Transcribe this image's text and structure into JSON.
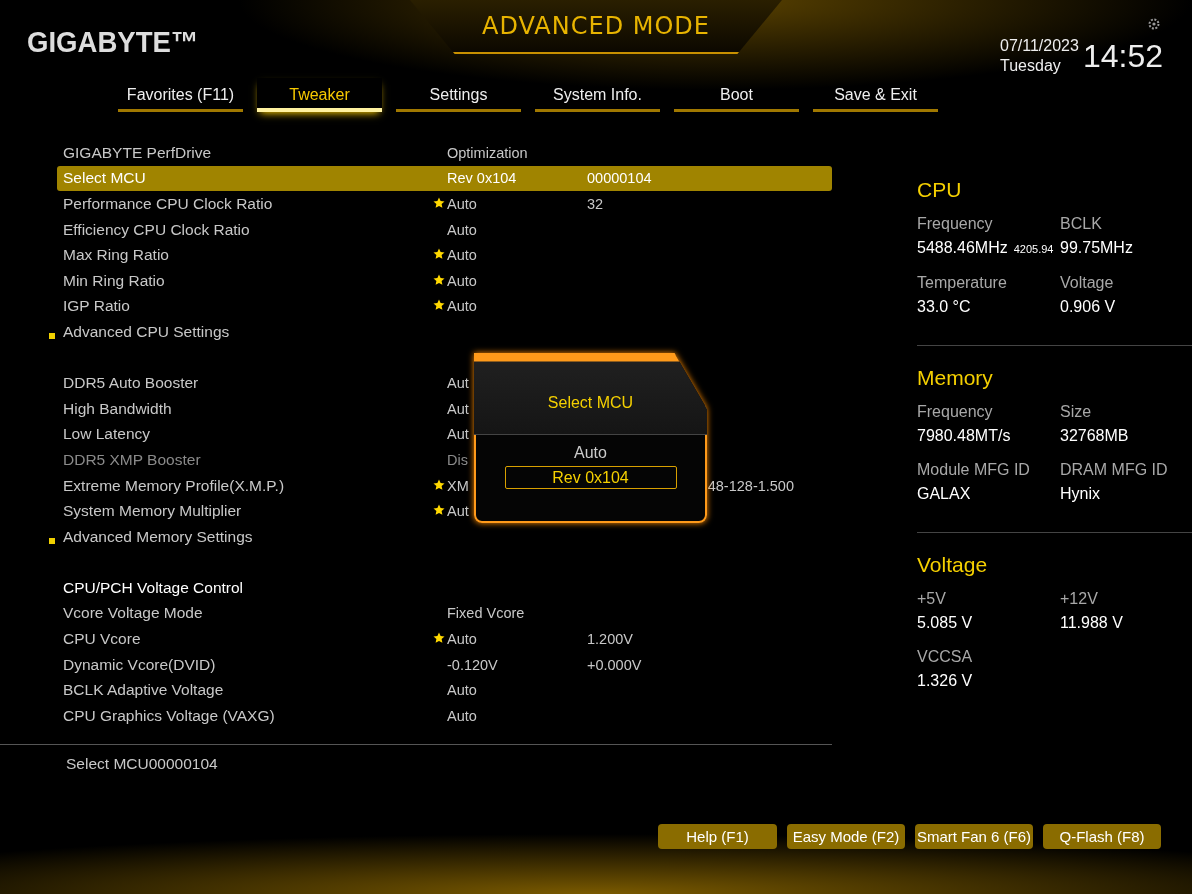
{
  "header": {
    "logo": "GIGABYTE™",
    "mode": "ADVANCED MODE",
    "date": "07/11/2023",
    "weekday": "Tuesday",
    "time": "14:52"
  },
  "tabs": [
    {
      "label": "Favorites (F11)",
      "selected": false
    },
    {
      "label": "Tweaker",
      "selected": true
    },
    {
      "label": "Settings",
      "selected": false
    },
    {
      "label": "System Info.",
      "selected": false
    },
    {
      "label": "Boot",
      "selected": false
    },
    {
      "label": "Save & Exit",
      "selected": false
    }
  ],
  "settings": {
    "groups": [
      [
        {
          "kind": "setting",
          "label": "GIGABYTE PerfDrive",
          "value": "Optimization",
          "starred": false,
          "selected": false,
          "disabled": false
        },
        {
          "kind": "setting",
          "label": "Select MCU",
          "value": "Rev 0x104",
          "value_2": "00000104",
          "starred": false,
          "selected": true,
          "disabled": false
        },
        {
          "kind": "setting",
          "label": "Performance CPU Clock Ratio",
          "value": "Auto",
          "value_2": "32",
          "starred": true,
          "selected": false,
          "disabled": false
        },
        {
          "kind": "setting",
          "label": "Efficiency CPU Clock Ratio",
          "value": "Auto",
          "starred": false,
          "selected": false,
          "disabled": false
        },
        {
          "kind": "setting",
          "label": "Max Ring Ratio",
          "value": "Auto",
          "starred": true,
          "selected": false,
          "disabled": false
        },
        {
          "kind": "setting",
          "label": "Min Ring Ratio",
          "value": "Auto",
          "starred": true,
          "selected": false,
          "disabled": false
        },
        {
          "kind": "setting",
          "label": "IGP Ratio",
          "value": "Auto",
          "starred": true,
          "selected": false,
          "disabled": false
        },
        {
          "kind": "submenu",
          "label": "Advanced CPU Settings"
        }
      ],
      [
        {
          "kind": "covered",
          "label": "DDR5 Auto Booster",
          "value": "Aut",
          "starred": false,
          "selected": false,
          "disabled": false
        },
        {
          "kind": "covered",
          "label": "High Bandwidth",
          "value": "Aut",
          "starred": false,
          "selected": false,
          "disabled": false
        },
        {
          "kind": "covered",
          "label": "Low Latency",
          "value": "Aut",
          "starred": false,
          "selected": false,
          "disabled": false
        },
        {
          "kind": "covered",
          "label": "DDR5 XMP Booster",
          "value": "Dis",
          "starred": false,
          "selected": false,
          "disabled": true
        },
        {
          "kind": "covered",
          "label": "Extreme Memory Profile(X.M.P.)",
          "value": "XM",
          "value_2": "48-128-1.500",
          "starred": true,
          "selected": false,
          "disabled": false
        },
        {
          "kind": "covered",
          "label": "System Memory Multiplier",
          "value": "Aut",
          "starred": true,
          "selected": false,
          "disabled": false
        },
        {
          "kind": "submenu",
          "label": "Advanced Memory Settings"
        }
      ],
      [
        {
          "kind": "header",
          "label": "CPU/PCH Voltage Control"
        },
        {
          "kind": "setting",
          "label": "Vcore Voltage Mode",
          "value": "Fixed Vcore",
          "starred": false,
          "selected": false,
          "disabled": false
        },
        {
          "kind": "setting",
          "label": "CPU Vcore",
          "value": "Auto",
          "value_2": "1.200V",
          "starred": true,
          "selected": false,
          "disabled": false
        },
        {
          "kind": "setting",
          "label": "Dynamic Vcore(DVID)",
          "value": "-0.120V",
          "value_2": "+0.000V",
          "starred": false,
          "selected": false,
          "disabled": false
        },
        {
          "kind": "setting",
          "label": "BCLK Adaptive Voltage",
          "value": "Auto",
          "starred": false,
          "selected": false,
          "disabled": false
        },
        {
          "kind": "setting",
          "label": "CPU Graphics Voltage (VAXG)",
          "value": "Auto",
          "starred": false,
          "selected": false,
          "disabled": false
        }
      ]
    ],
    "help": "Select MCU00000104"
  },
  "popup": {
    "title": "Select MCU",
    "options": [
      {
        "label": "Auto",
        "selected": false
      },
      {
        "label": "Rev 0x104",
        "selected": true
      }
    ]
  },
  "info": [
    {
      "title": "CPU",
      "items": [
        {
          "label": "Frequency",
          "value": "5488.46MHz",
          "extra": "4205.94"
        },
        {
          "label": "BCLK",
          "value": "99.75MHz"
        },
        {
          "label": "Temperature",
          "value": "33.0 °C"
        },
        {
          "label": "Voltage",
          "value": "0.906 V"
        }
      ]
    },
    {
      "title": "Memory",
      "items": [
        {
          "label": "Frequency",
          "value": "7980.48MT/s"
        },
        {
          "label": "Size",
          "value": "32768MB"
        },
        {
          "label": "Module MFG ID",
          "value": "GALAX"
        },
        {
          "label": "DRAM MFG ID",
          "value": "Hynix"
        }
      ]
    },
    {
      "title": "Voltage",
      "items": [
        {
          "label": "+5V",
          "value": "5.085 V"
        },
        {
          "label": "+12V",
          "value": "11.988 V"
        },
        {
          "label": "VCCSA",
          "value": "1.326 V"
        }
      ]
    }
  ],
  "footer": [
    "Help (F1)",
    "Easy Mode (F2)",
    "Smart Fan 6 (F6)",
    "Q-Flash (F8)"
  ]
}
